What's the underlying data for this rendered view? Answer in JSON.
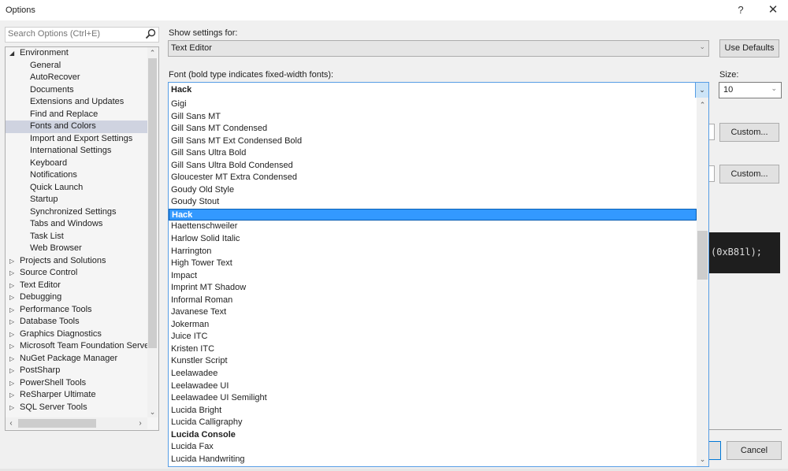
{
  "window": {
    "title": "Options",
    "help_label": "?",
    "close_label": "✕"
  },
  "search": {
    "placeholder": "Search Options (Ctrl+E)",
    "value": ""
  },
  "tree": {
    "items": [
      {
        "label": "Environment",
        "level": 0,
        "expanded": true
      },
      {
        "label": "General",
        "level": 1
      },
      {
        "label": "AutoRecover",
        "level": 1
      },
      {
        "label": "Documents",
        "level": 1
      },
      {
        "label": "Extensions and Updates",
        "level": 1
      },
      {
        "label": "Find and Replace",
        "level": 1
      },
      {
        "label": "Fonts and Colors",
        "level": 1,
        "selected": true
      },
      {
        "label": "Import and Export Settings",
        "level": 1
      },
      {
        "label": "International Settings",
        "level": 1
      },
      {
        "label": "Keyboard",
        "level": 1
      },
      {
        "label": "Notifications",
        "level": 1
      },
      {
        "label": "Quick Launch",
        "level": 1
      },
      {
        "label": "Startup",
        "level": 1
      },
      {
        "label": "Synchronized Settings",
        "level": 1
      },
      {
        "label": "Tabs and Windows",
        "level": 1
      },
      {
        "label": "Task List",
        "level": 1
      },
      {
        "label": "Web Browser",
        "level": 1
      },
      {
        "label": "Projects and Solutions",
        "level": 0,
        "expanded": false
      },
      {
        "label": "Source Control",
        "level": 0,
        "expanded": false
      },
      {
        "label": "Text Editor",
        "level": 0,
        "expanded": false
      },
      {
        "label": "Debugging",
        "level": 0,
        "expanded": false
      },
      {
        "label": "Performance Tools",
        "level": 0,
        "expanded": false
      },
      {
        "label": "Database Tools",
        "level": 0,
        "expanded": false
      },
      {
        "label": "Graphics Diagnostics",
        "level": 0,
        "expanded": false
      },
      {
        "label": "Microsoft Team Foundation Server",
        "level": 0,
        "expanded": false
      },
      {
        "label": "NuGet Package Manager",
        "level": 0,
        "expanded": false
      },
      {
        "label": "PostSharp",
        "level": 0,
        "expanded": false
      },
      {
        "label": "PowerShell Tools",
        "level": 0,
        "expanded": false
      },
      {
        "label": "ReSharper Ultimate",
        "level": 0,
        "expanded": false
      },
      {
        "label": "SQL Server Tools",
        "level": 0,
        "expanded": false
      }
    ]
  },
  "settings": {
    "show_settings_label": "Show settings for:",
    "show_settings_value": "Text Editor",
    "use_defaults_label": "Use Defaults",
    "font_label": "Font (bold type indicates fixed-width fonts):",
    "font_value": "Hack",
    "size_label": "Size:",
    "size_value": "10",
    "custom_label_1": "Custom...",
    "custom_label_2": "Custom...",
    "preview_text": "(0xB81l);",
    "cancel_label": "Cancel"
  },
  "font_list": {
    "items": [
      {
        "name": "Gigi"
      },
      {
        "name": "Gill Sans MT"
      },
      {
        "name": "Gill Sans MT Condensed"
      },
      {
        "name": "Gill Sans MT Ext Condensed Bold"
      },
      {
        "name": "Gill Sans Ultra Bold"
      },
      {
        "name": "Gill Sans Ultra Bold Condensed"
      },
      {
        "name": "Gloucester MT Extra Condensed"
      },
      {
        "name": "Goudy Old Style"
      },
      {
        "name": "Goudy Stout"
      },
      {
        "name": "Hack",
        "fixed_width": true,
        "selected": true
      },
      {
        "name": "Haettenschweiler"
      },
      {
        "name": "Harlow Solid Italic"
      },
      {
        "name": "Harrington"
      },
      {
        "name": "High Tower Text"
      },
      {
        "name": "Impact"
      },
      {
        "name": "Imprint MT Shadow"
      },
      {
        "name": "Informal Roman"
      },
      {
        "name": "Javanese Text"
      },
      {
        "name": "Jokerman"
      },
      {
        "name": "Juice ITC"
      },
      {
        "name": "Kristen ITC"
      },
      {
        "name": "Kunstler Script"
      },
      {
        "name": "Leelawadee"
      },
      {
        "name": "Leelawadee UI"
      },
      {
        "name": "Leelawadee UI Semilight"
      },
      {
        "name": "Lucida Bright"
      },
      {
        "name": "Lucida Calligraphy"
      },
      {
        "name": "Lucida Console",
        "fixed_width": true
      },
      {
        "name": "Lucida Fax"
      },
      {
        "name": "Lucida Handwriting"
      }
    ]
  },
  "colors": {
    "accent": "#569de5",
    "selection": "#3399ff",
    "tree_selection": "#cfd3e0",
    "preview_bg": "#1e1e1e"
  }
}
